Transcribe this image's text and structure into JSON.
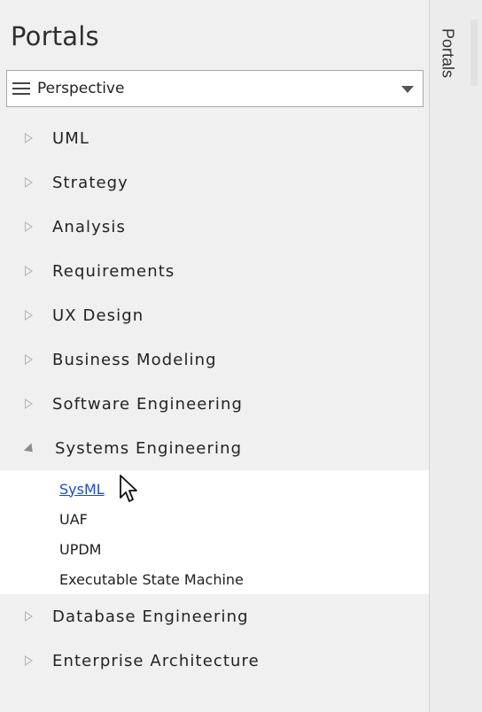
{
  "panel": {
    "title": "Portals",
    "dropdown": {
      "label": "Perspective"
    },
    "tree": [
      {
        "label": "UML",
        "expanded": false
      },
      {
        "label": "Strategy",
        "expanded": false
      },
      {
        "label": "Analysis",
        "expanded": false
      },
      {
        "label": "Requirements",
        "expanded": false
      },
      {
        "label": "UX Design",
        "expanded": false
      },
      {
        "label": "Business Modeling",
        "expanded": false
      },
      {
        "label": "Software Engineering",
        "expanded": false
      },
      {
        "label": "Systems Engineering",
        "expanded": true,
        "children": [
          {
            "label": "SysML",
            "link": true
          },
          {
            "label": "UAF",
            "link": false
          },
          {
            "label": "UPDM",
            "link": false
          },
          {
            "label": "Executable State Machine",
            "link": false
          }
        ]
      },
      {
        "label": "Database Engineering",
        "expanded": false
      },
      {
        "label": "Enterprise Architecture",
        "expanded": false
      }
    ]
  },
  "side_tab": {
    "label": "Portals"
  },
  "colors": {
    "background": "#f0f0f0",
    "link": "#1a4bd6",
    "text": "#232323"
  }
}
